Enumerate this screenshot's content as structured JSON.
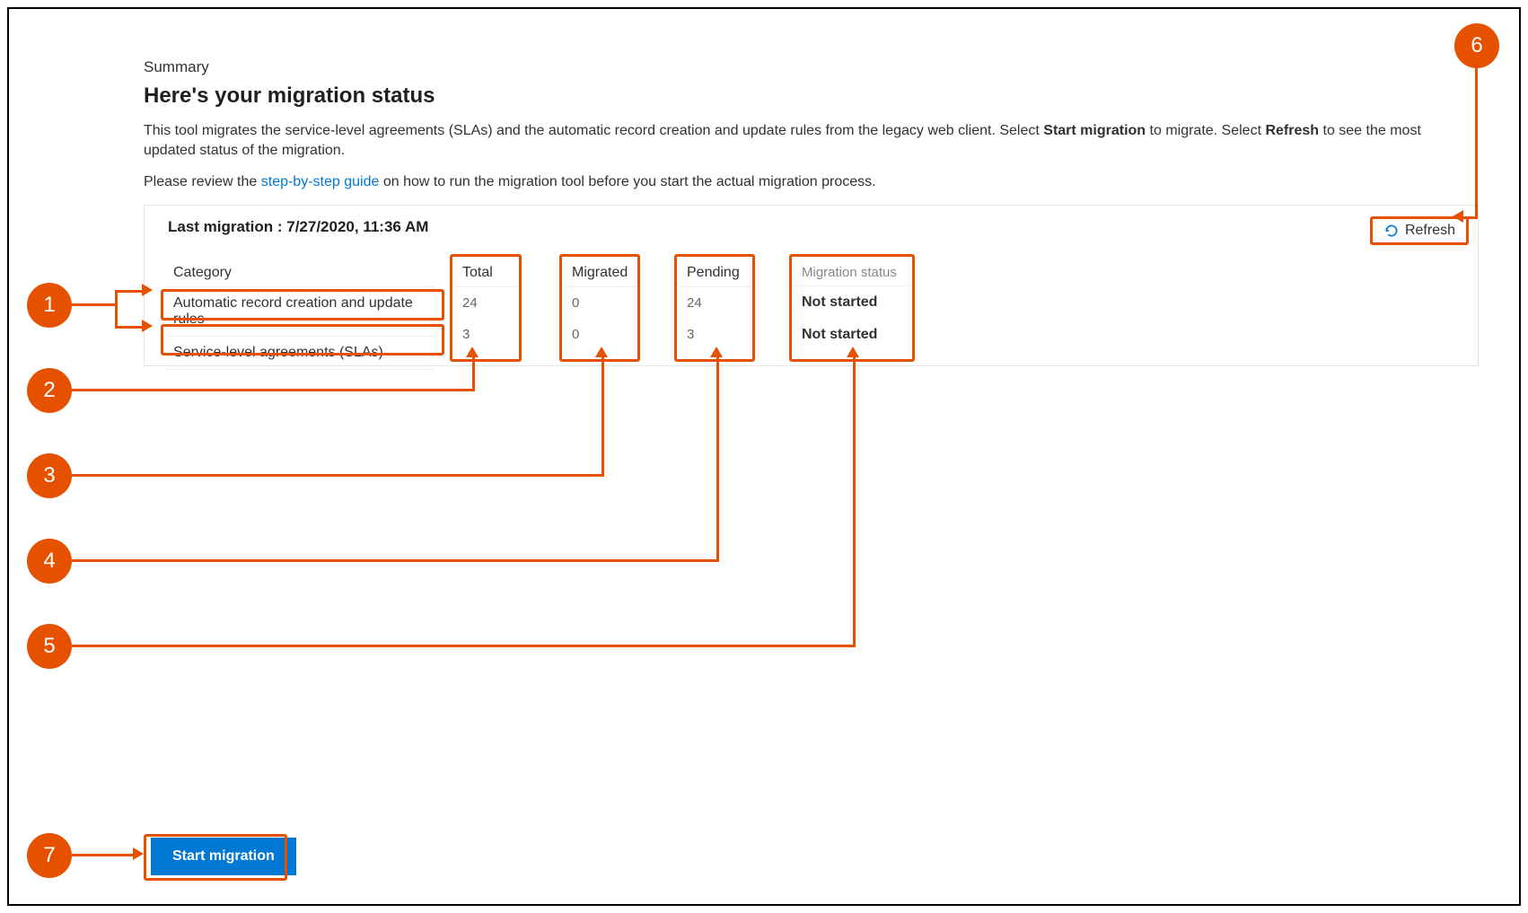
{
  "summary_label": "Summary",
  "heading": "Here's your migration status",
  "description": {
    "pre": "This tool migrates the service-level agreements (SLAs) and the automatic record creation and update rules from the legacy web client. Select ",
    "b1": "Start migration",
    "mid": " to migrate. Select ",
    "b2": "Refresh",
    "post": " to see the most updated status of the migration."
  },
  "guide_line": {
    "pre": "Please review the ",
    "link": "step-by-step guide",
    "post": " on how to run the migration tool before you start the actual migration process."
  },
  "panel": {
    "last_migration_label": "Last migration :",
    "last_migration_time": "7/27/2020, 11:36 AM",
    "refresh_label": "Refresh"
  },
  "columns": {
    "category": "Category",
    "total": "Total",
    "migrated": "Migrated",
    "pending": "Pending",
    "status": "Migration status"
  },
  "rows": [
    {
      "category": "Automatic record creation and update rules",
      "total": "24",
      "migrated": "0",
      "pending": "24",
      "status": "Not started"
    },
    {
      "category": "Service-level agreements (SLAs)",
      "total": "3",
      "migrated": "0",
      "pending": "3",
      "status": "Not started"
    }
  ],
  "start_button": "Start migration",
  "callouts": {
    "c1": "1",
    "c2": "2",
    "c3": "3",
    "c4": "4",
    "c5": "5",
    "c6": "6",
    "c7": "7"
  }
}
